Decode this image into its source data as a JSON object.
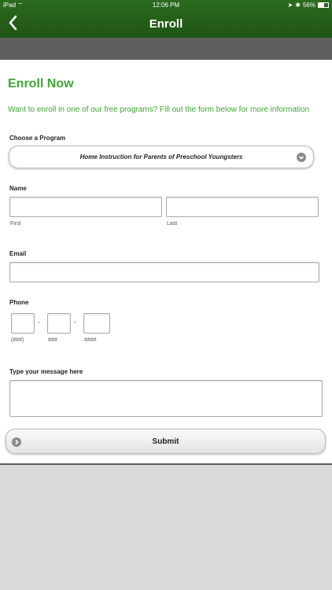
{
  "status_bar": {
    "device": "iPad",
    "time": "12:06 PM",
    "battery": "56%",
    "battery_level": 0.56
  },
  "header": {
    "title": "Enroll"
  },
  "form": {
    "heading": "Enroll Now",
    "intro": "Want to enroll in one of our free programs? Fill out the form below for more information",
    "program": {
      "label": "Choose a Program",
      "selected": "Home Instruction for Parents of Preschool Youngsters"
    },
    "name": {
      "label": "Name",
      "first_label": "First",
      "last_label": "Last",
      "first_value": "",
      "last_value": ""
    },
    "email": {
      "label": "Email",
      "value": ""
    },
    "phone": {
      "label": "Phone",
      "area_hint": "(###)",
      "prefix_hint": "###",
      "line_hint": "####",
      "separator": "-"
    },
    "message": {
      "label": "Type your message here",
      "value": ""
    },
    "submit_label": "Submit"
  }
}
